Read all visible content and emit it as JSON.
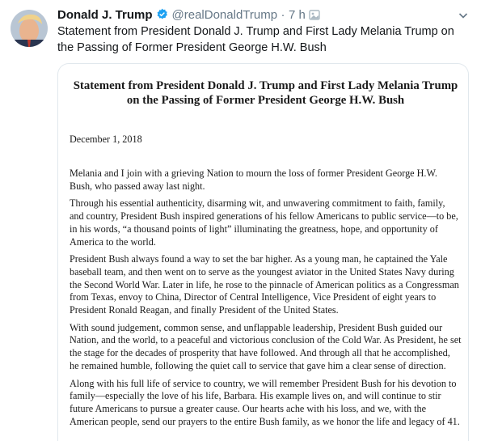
{
  "tweet": {
    "author_name": "Donald J. Trump",
    "handle": "@realDonaldTrump",
    "separator": "·",
    "time": "7 h",
    "text": "Statement from President Donald J. Trump and First Lady Melania Trump on the Passing of Former President George H.W. Bush",
    "icons": {
      "verified": "verified-badge-icon",
      "extra": "photo-icon",
      "menu": "chevron-down-icon"
    },
    "colors": {
      "verified": "#1da1f2",
      "muted": "#657786",
      "border": "#e1e8ed"
    }
  },
  "statement": {
    "title": "Statement from President Donald J. Trump and First Lady Melania Trump on the Passing of Former President George H.W. Bush",
    "date": "December 1, 2018",
    "paragraphs": [
      "Melania and I join with a grieving Nation to mourn the loss of former President George H.W. Bush, who passed away last night.",
      "Through his essential authenticity, disarming wit, and unwavering commitment to faith, family, and country, President Bush inspired generations of his fellow Americans to public service—to be, in his words, “a thousand points of light” illuminating the greatness, hope, and opportunity of America to the world.",
      "President Bush always found a way to set the bar higher.  As a young man, he captained the Yale baseball team, and then went on to serve as the youngest aviator in the United States Navy during the Second World War.  Later in life, he rose to the pinnacle of American politics as a Congressman from Texas, envoy to China, Director of Central Intelligence, Vice President of eight years to President Ronald Reagan, and finally President of the United States.",
      "With sound judgement, common sense, and unflappable leadership, President Bush guided our Nation, and the world, to a peaceful and victorious conclusion of the Cold War.  As President, he set the stage for the decades of prosperity that have followed.  And through all that he accomplished, he remained humble, following the quiet call to service that gave him a clear sense of direction.",
      "Along with his full life of service to country, we will remember President Bush for his devotion to family—especially the love of his life, Barbara.  His example lives on, and will continue to stir future Americans to pursue a greater cause.  Our hearts ache with his loss, and we, with the American people, send our prayers to the entire Bush family, as we honor the life and legacy of 41."
    ]
  }
}
